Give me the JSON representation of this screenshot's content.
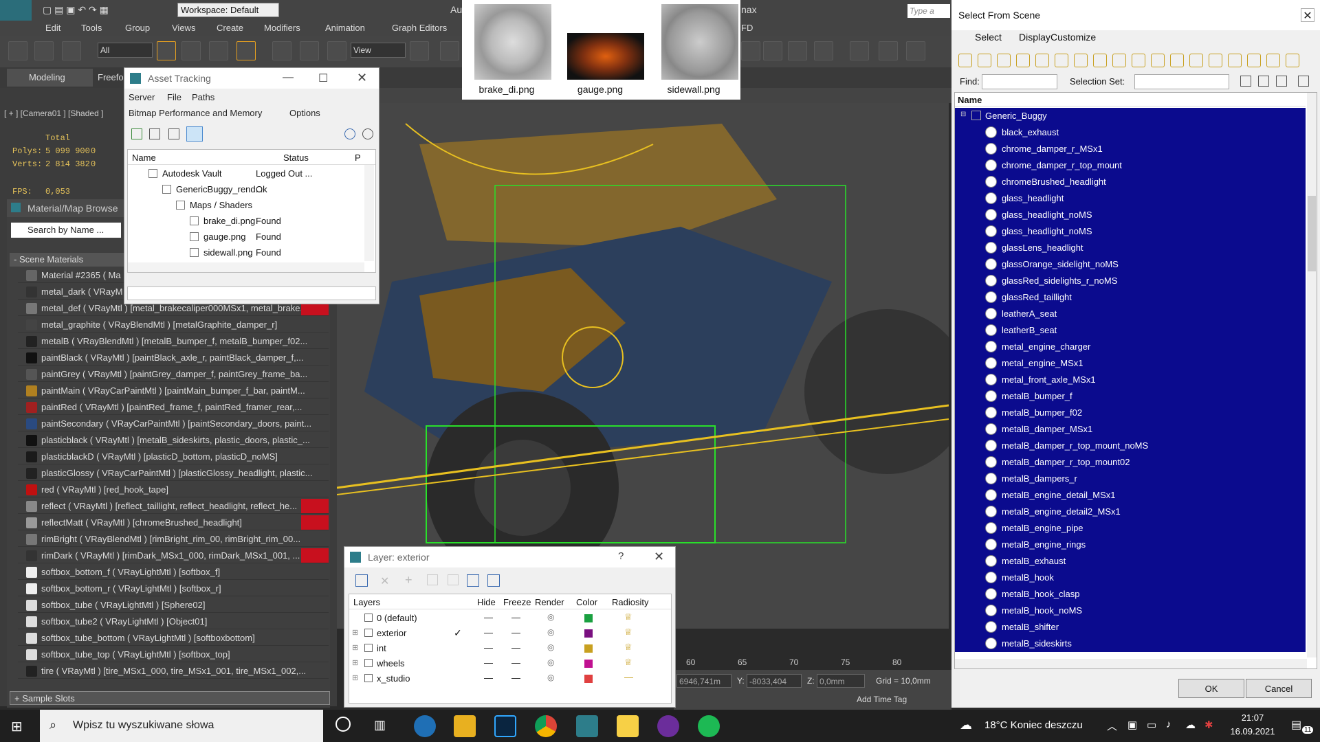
{
  "app": {
    "workspace_label": "Workspace: Default",
    "search_placeholder": "Type a",
    "menus": [
      "Edit",
      "Tools",
      "Group",
      "Views",
      "Create",
      "Modifiers",
      "Animation",
      "Graph Editors"
    ],
    "title_fragment_au": "Au",
    "title_fragment_max": "nax",
    "title_fragment_fd": "FD",
    "ribbon_tabs": [
      "Modeling",
      "Freefo"
    ],
    "selection_filter": "All",
    "ref_coord": "View"
  },
  "viewport": {
    "label": "[ + ] [Camera01 ] [Shaded ]",
    "stats": {
      "total_label": "Total",
      "polys_label": "Polys:",
      "polys_value": "5 099 900",
      "polys_sel": "0",
      "verts_label": "Verts:",
      "verts_value": "2 814 382",
      "verts_sel": "0",
      "fps_label": "FPS:",
      "fps_value": "0,053"
    }
  },
  "material_browser": {
    "title": "Material/Map Browse",
    "search_placeholder": "Search by Name ...",
    "group": "- Scene Materials",
    "sample_slots": "+ Sample Slots",
    "materials": [
      {
        "name": "Material #2365  ( Ma",
        "red": false,
        "color": "#666"
      },
      {
        "name": "metal_dark  ( VRayM",
        "red": false,
        "color": "#333"
      },
      {
        "name": "metal_def  ( VRayMtl ) [metal_brakecaliper000MSx1, metal_brake...",
        "red": true,
        "color": "#777"
      },
      {
        "name": "metal_graphite  ( VRayBlendMtl ) [metalGraphite_damper_r]",
        "red": false,
        "color": "#444"
      },
      {
        "name": "metalB  ( VRayBlendMtl ) [metalB_bumper_f, metalB_bumper_f02...",
        "red": false,
        "color": "#222"
      },
      {
        "name": "paintBlack  ( VRayMtl ) [paintBlack_axle_r, paintBlack_damper_f,...",
        "red": false,
        "color": "#111"
      },
      {
        "name": "paintGrey  ( VRayMtl ) [paintGrey_damper_f, paintGrey_frame_ba...",
        "red": false,
        "color": "#555"
      },
      {
        "name": "paintMain  ( VRayCarPaintMtl ) [paintMain_bumper_f_bar, paintM...",
        "red": false,
        "color": "#b08020"
      },
      {
        "name": "paintRed  ( VRayMtl ) [paintRed_frame_f, paintRed_framer_rear,...",
        "red": false,
        "color": "#a02020"
      },
      {
        "name": "paintSecondary  ( VRayCarPaintMtl ) [paintSecondary_doors, paint...",
        "red": false,
        "color": "#2a4a80"
      },
      {
        "name": "plasticblack  ( VRayMtl ) [metalB_sideskirts, plastic_doors, plastic_...",
        "red": false,
        "color": "#111"
      },
      {
        "name": "plasticblackD  ( VRayMtl ) [plasticD_bottom, plasticD_noMS]",
        "red": false,
        "color": "#1a1a1a"
      },
      {
        "name": "plasticGlossy  ( VRayCarPaintMtl ) [plasticGlossy_headlight, plastic...",
        "red": false,
        "color": "#222"
      },
      {
        "name": "red  ( VRayMtl ) [red_hook_tape]",
        "red": false,
        "color": "#c01010"
      },
      {
        "name": "reflect  ( VRayMtl ) [reflect_taillight, reflect_headlight, reflect_he...",
        "red": true,
        "color": "#888"
      },
      {
        "name": "reflectMatt  ( VRayMtl ) [chromeBrushed_headlight]",
        "red": true,
        "color": "#999"
      },
      {
        "name": "rimBright  ( VRayBlendMtl ) [rimBright_rim_00, rimBright_rim_00...",
        "red": false,
        "color": "#777"
      },
      {
        "name": "rimDark  ( VRayMtl ) [rimDark_MSx1_000, rimDark_MSx1_001, ...",
        "red": true,
        "color": "#333"
      },
      {
        "name": "softbox_bottom_f  ( VRayLightMtl ) [softbox_f]",
        "red": false,
        "color": "#eee"
      },
      {
        "name": "softbox_bottom_r  ( VRayLightMtl ) [softbox_r]",
        "red": false,
        "color": "#eee"
      },
      {
        "name": "softbox_tube  ( VRayLightMtl ) [Sphere02]",
        "red": false,
        "color": "#ddd"
      },
      {
        "name": "softbox_tube2  ( VRayLightMtl ) [Object01]",
        "red": false,
        "color": "#ddd"
      },
      {
        "name": "softbox_tube_bottom  ( VRayLightMtl ) [softboxbottom]",
        "red": false,
        "color": "#ddd"
      },
      {
        "name": "softbox_tube_top  ( VRayLightMtl ) [softbox_top]",
        "red": false,
        "color": "#ddd"
      },
      {
        "name": "tire  ( VRayMtl ) [tire_MSx1_000, tire_MSx1_001, tire_MSx1_002,...",
        "red": false,
        "color": "#222"
      }
    ]
  },
  "asset_tracking": {
    "title": "Asset Tracking",
    "menu1": [
      "Server",
      "File",
      "Paths"
    ],
    "menu2": [
      "Bitmap Performance and Memory",
      "Options"
    ],
    "col_name": "Name",
    "col_status": "Status",
    "col_p": "P",
    "rows": [
      {
        "name": "Autodesk Vault",
        "status": "Logged Out ...",
        "indent": 0
      },
      {
        "name": "GenericBuggy_rend...",
        "status": "Ok",
        "indent": 1
      },
      {
        "name": "Maps / Shaders",
        "status": "",
        "indent": 2
      },
      {
        "name": "brake_di.png",
        "status": "Found",
        "indent": 3
      },
      {
        "name": "gauge.png",
        "status": "Found",
        "indent": 3
      },
      {
        "name": "sidewall.png",
        "status": "Found",
        "indent": 3
      }
    ]
  },
  "thumbnails": [
    {
      "label": "brake_di.png"
    },
    {
      "label": "gauge.png"
    },
    {
      "label": "sidewall.png"
    }
  ],
  "select_from_scene": {
    "title": "Select From Scene",
    "menus": [
      "Select",
      "Display",
      "Customize"
    ],
    "find_label": "Find:",
    "selection_set_label": "Selection Set:",
    "col_name": "Name",
    "root": "Generic_Buggy",
    "items": [
      "black_exhaust",
      "chrome_damper_r_MSx1",
      "chrome_damper_r_top_mount",
      "chromeBrushed_headlight",
      "glass_headlight",
      "glass_headlight_noMS",
      "glass_headlight_noMS",
      "glassLens_headlight",
      "glassOrange_sidelight_noMS",
      "glassRed_sidelights_r_noMS",
      "glassRed_taillight",
      "leatherA_seat",
      "leatherB_seat",
      "metal_engine_charger",
      "metal_engine_MSx1",
      "metal_front_axle_MSx1",
      "metalB_bumper_f",
      "metalB_bumper_f02",
      "metalB_damper_MSx1",
      "metalB_damper_r_top_mount_noMS",
      "metalB_damper_r_top_mount02",
      "metalB_dampers_r",
      "metalB_engine_detail_MSx1",
      "metalB_engine_detail2_MSx1",
      "metalB_engine_pipe",
      "metalB_engine_rings",
      "metalB_exhaust",
      "metalB_hook",
      "metalB_hook_clasp",
      "metalB_hook_noMS",
      "metalB_shifter",
      "metalB_sideskirts"
    ],
    "ok_label": "OK",
    "cancel_label": "Cancel"
  },
  "layer_dialog": {
    "title": "Layer: exterior",
    "help": "?",
    "cols": [
      "Layers",
      "Hide",
      "Freeze",
      "Render",
      "Color",
      "Radiosity"
    ],
    "rows": [
      {
        "name": "0 (default)",
        "color": "#1aa040",
        "active": false
      },
      {
        "name": "exterior",
        "color": "#7a1080",
        "active": true
      },
      {
        "name": "int",
        "color": "#c8a020",
        "active": false
      },
      {
        "name": "wheels",
        "color": "#c01090",
        "active": false
      },
      {
        "name": "x_studio",
        "color": "#e04040",
        "active": false
      }
    ]
  },
  "status_bar": {
    "timeline_ticks": [
      "60",
      "65",
      "70",
      "75",
      "80"
    ],
    "x_value": "6946,741m",
    "y_label": "Y:",
    "y_value": "-8033,404",
    "z_label": "Z:",
    "z_value": "0,0mm",
    "grid": "Grid = 10,0mm",
    "add_time_tag": "Add Time Tag"
  },
  "taskbar": {
    "search_placeholder": "Wpisz tu wyszukiwane słowa",
    "weather": "18°C  Koniec deszczu",
    "time": "21:07",
    "date": "16.09.2021",
    "notif_count": "11"
  }
}
